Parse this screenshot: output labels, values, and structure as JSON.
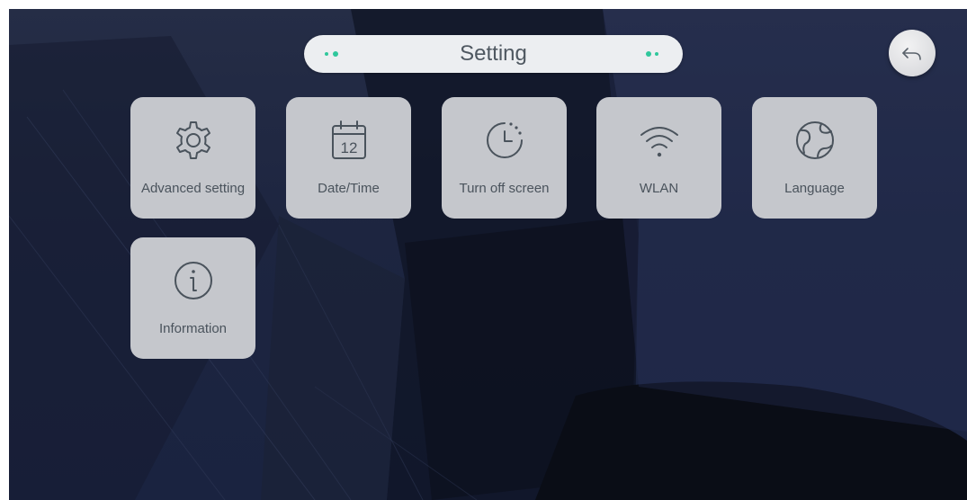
{
  "header": {
    "title": "Setting"
  },
  "back_button": {
    "icon": "back-arrow-icon"
  },
  "tiles": [
    {
      "label": "Advanced setting",
      "icon": "gear-icon"
    },
    {
      "label": "Date/Time",
      "icon": "calendar-icon",
      "icon_text": "12"
    },
    {
      "label": "Turn off screen",
      "icon": "clock-timer-icon"
    },
    {
      "label": "WLAN",
      "icon": "wifi-icon"
    },
    {
      "label": "Language",
      "icon": "globe-icon"
    },
    {
      "label": "Information",
      "icon": "info-icon"
    }
  ],
  "colors": {
    "accent_dot": "#2fc79c",
    "tile_bg": "#c5c7cc",
    "icon_stroke": "#4a535c"
  }
}
